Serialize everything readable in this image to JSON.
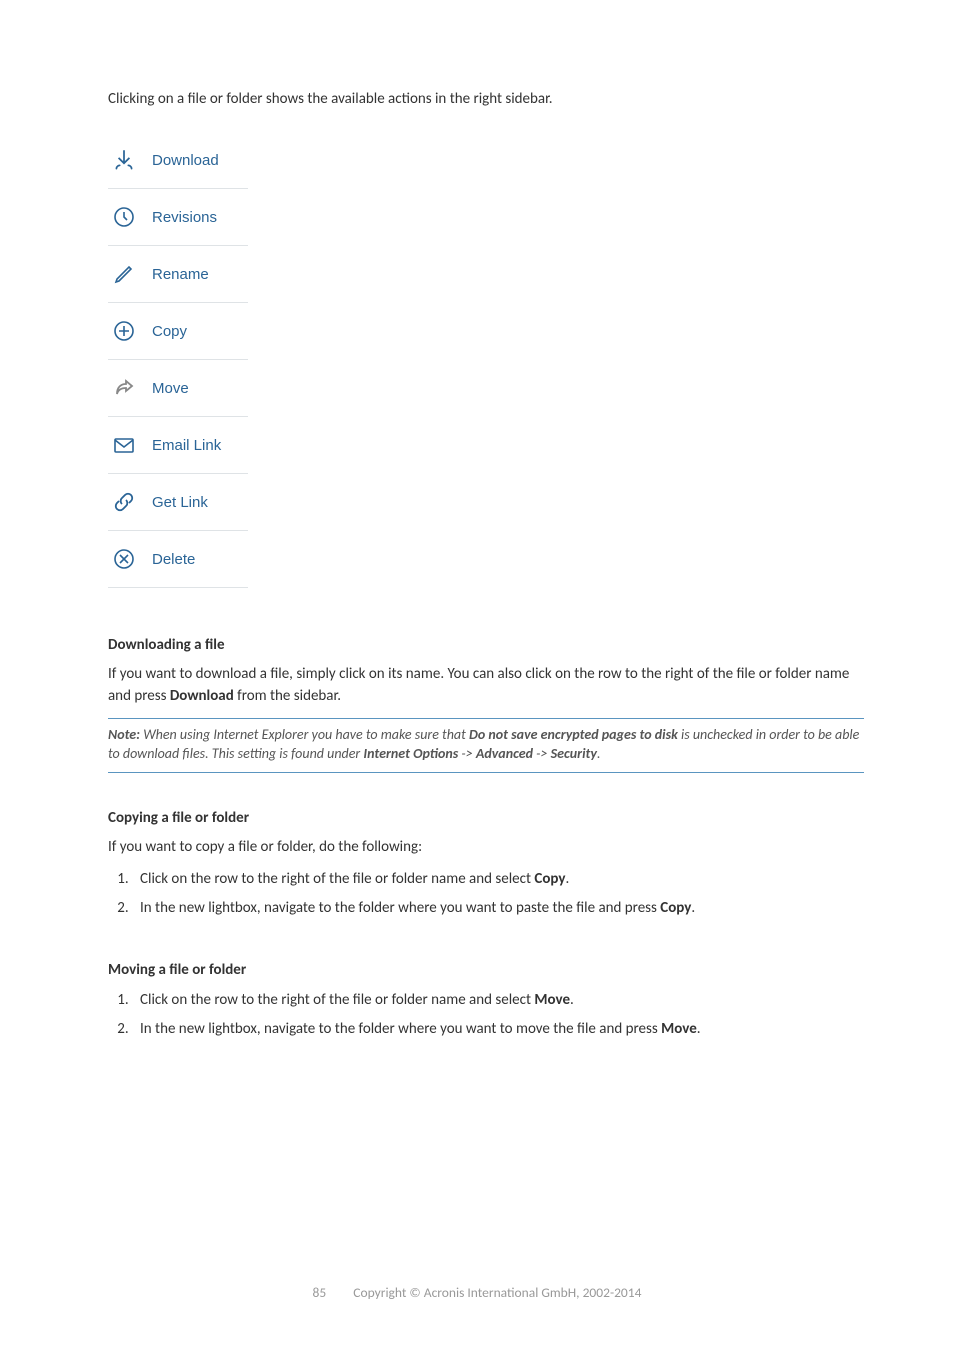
{
  "intro": "Clicking on a file or folder shows the available actions in the right sidebar.",
  "actions": [
    {
      "label": "Download",
      "icon": "download-icon"
    },
    {
      "label": "Revisions",
      "icon": "clock-icon"
    },
    {
      "label": "Rename",
      "icon": "pencil-icon"
    },
    {
      "label": "Copy",
      "icon": "plus-circle-icon"
    },
    {
      "label": "Move",
      "icon": "share-arrow-icon"
    },
    {
      "label": "Email Link",
      "icon": "envelope-icon"
    },
    {
      "label": "Get Link",
      "icon": "link-icon"
    },
    {
      "label": "Delete",
      "icon": "x-circle-icon"
    }
  ],
  "download": {
    "heading": "Downloading a file",
    "body_pre": "If you want to download a file, simply click on its name. You can also click on the row to the right of the file or folder name and press ",
    "body_bold": "Download",
    "body_post": " from the sidebar.",
    "note_label": "Note:",
    "note_text1": " When using Internet Explorer you have to make sure that ",
    "note_b1": "Do not save encrypted pages to disk",
    "note_text2": " is unchecked in order to be able to download files. This setting is found under ",
    "note_b2": "Internet Options",
    "note_arrow1": " -> ",
    "note_b3": "Advanced",
    "note_arrow2": " -> ",
    "note_b4": "Security",
    "note_end": "."
  },
  "copy": {
    "heading": "Copying a file or folder",
    "lead": "If you want to copy a file or folder, do the following:",
    "step1_pre": "Click on the row to the right of the file or folder name and select ",
    "step1_bold": "Copy",
    "step1_post": ".",
    "step2_pre": "In the new lightbox, navigate to the folder where you want to paste the file and press ",
    "step2_bold": "Copy",
    "step2_post": "."
  },
  "move": {
    "heading": "Moving a file or folder",
    "step1_pre": "Click on the row to the right of the file or folder name and select ",
    "step1_bold": "Move",
    "step1_post": ".",
    "step2_pre": "In the new lightbox, navigate to the folder where you want to move the file and press ",
    "step2_bold": "Move",
    "step2_post": "."
  },
  "footer": {
    "page": "85",
    "copyright": "Copyright © Acronis International GmbH, 2002-2014"
  }
}
